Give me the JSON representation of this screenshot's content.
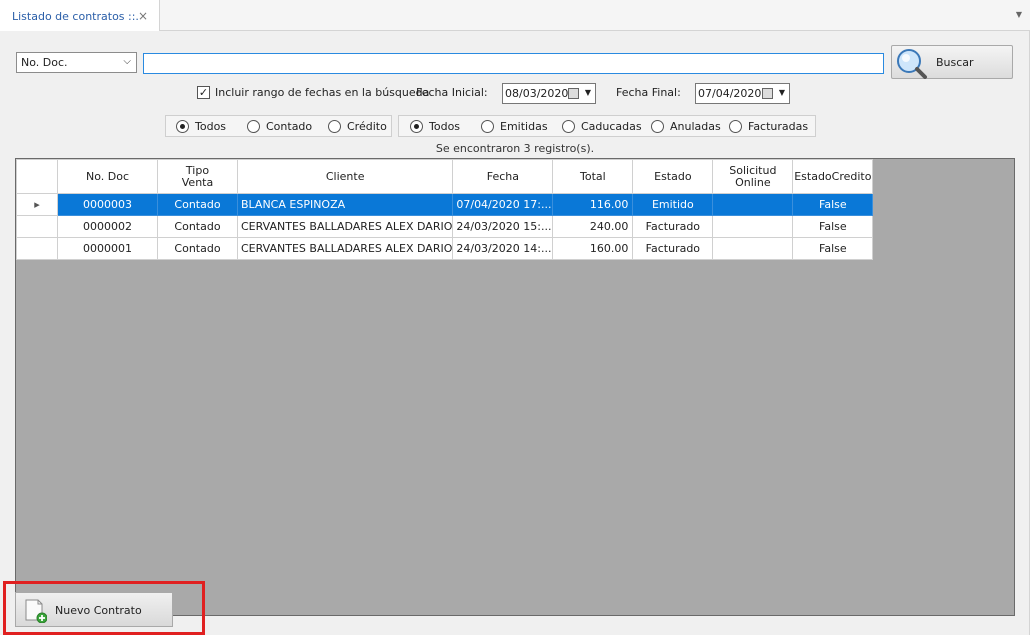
{
  "tab": {
    "title": "Listado de contratos ::.",
    "close": "×",
    "menu": "▼"
  },
  "search": {
    "field_selected": "No. Doc.",
    "field_chevron": "⌵",
    "query": "",
    "button_label": "Buscar"
  },
  "date_filter": {
    "checkbox_label": "Incluir rango de fechas en la búsqueda",
    "checked": true,
    "check_mark": "✓",
    "start_label": "Fecha Inicial:",
    "start_value": "08/03/2020",
    "end_label": "Fecha Final:",
    "end_value": "07/04/2020",
    "dropdown_glyph": "▼"
  },
  "sale_type": {
    "options": [
      "Todos",
      "Contado",
      "Crédito"
    ],
    "selected": "Todos"
  },
  "status_filter": {
    "options": [
      "Todos",
      "Emitidas",
      "Caducadas",
      "Anuladas",
      "Facturadas"
    ],
    "selected": "Todos"
  },
  "result_count": "Se encontraron 3 registro(s).",
  "table": {
    "columns": [
      "No. Doc",
      "Tipo\nVenta",
      "Cliente",
      "Fecha",
      "Total",
      "Estado",
      "Solicitud\nOnline",
      "EstadoCredito"
    ],
    "column_lines": [
      [
        "No. Doc"
      ],
      [
        "Tipo",
        "Venta"
      ],
      [
        "Cliente"
      ],
      [
        "Fecha"
      ],
      [
        "Total"
      ],
      [
        "Estado"
      ],
      [
        "Solicitud",
        "Online"
      ],
      [
        "EstadoCredito"
      ]
    ],
    "row_indicator": "▸",
    "selected_row": 0,
    "rows": [
      [
        "0000003",
        "Contado",
        "BLANCA ESPINOZA",
        "07/04/2020 17:...",
        "116.00",
        "Emitido",
        "",
        "False"
      ],
      [
        "0000002",
        "Contado",
        "CERVANTES BALLADARES ALEX DARIO",
        "24/03/2020 15:...",
        "240.00",
        "Facturado",
        "",
        "False"
      ],
      [
        "0000001",
        "Contado",
        "CERVANTES BALLADARES ALEX DARIO",
        "24/03/2020 14:...",
        "160.00",
        "Facturado",
        "",
        "False"
      ]
    ]
  },
  "footer": {
    "new_button_label": "Nuevo Contrato"
  },
  "colors": {
    "accent": "#0a78d7",
    "highlight": "#e02020",
    "grid_background": "#a9a9a9"
  }
}
